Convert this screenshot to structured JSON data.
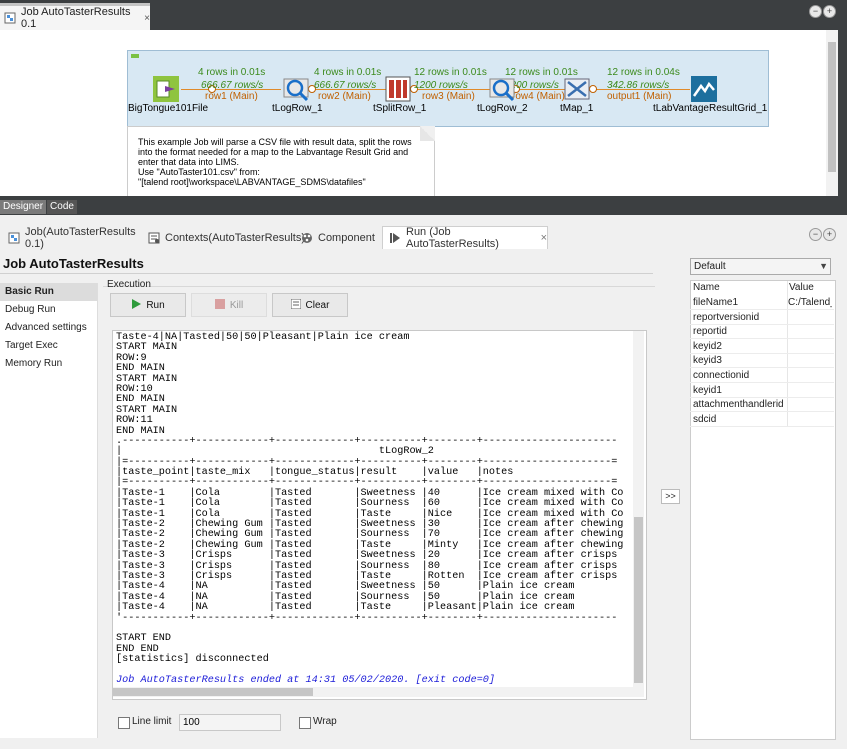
{
  "editor": {
    "tab_title": "Job AutoTasterResults 0.1",
    "tab_close": "×",
    "minimize": "−",
    "maximize": "+",
    "bottom_tabs": [
      "Designer",
      "Code"
    ]
  },
  "flows": [
    {
      "rows": "4 rows in 0.01s",
      "rate": "666.67 rows/s",
      "name": "row1 (Main)"
    },
    {
      "rows": "4 rows in 0.01s",
      "rate": "666.67 rows/s",
      "name": "row2 (Main)"
    },
    {
      "rows": "12 rows in 0.01s",
      "rate": "1200 rows/s",
      "name": "row3 (Main)"
    },
    {
      "rows": "12 rows in 0.01s",
      "rate": "1200 rows/s",
      "name": "row4 (Main)"
    },
    {
      "rows": "12 rows in 0.04s",
      "rate": "342.86 rows/s",
      "name": "output1 (Main)"
    }
  ],
  "components": [
    "BigTongue101File",
    "tLogRow_1",
    "tSplitRow_1",
    "tLogRow_2",
    "tMap_1",
    "tLabVantageResultGrid_1"
  ],
  "note_lines": [
    "This example Job will parse a CSV file with result data, split the rows",
    "into the format needed for a map to the Labvantage Result Grid and",
    "enter that data into LIMS.",
    "Use \"AutoTaster101.csv\" from:",
    "\"[talend root]\\workspace\\LABVANTAGE_SDMS\\datafiles\""
  ],
  "lower_tabs": [
    "Job(AutoTasterResults 0.1)",
    "Contexts(AutoTasterResults)",
    "Component",
    "Run (Job AutoTasterResults)"
  ],
  "lower_tab_close": "×",
  "run": {
    "title": "Job AutoTasterResults",
    "side_items": [
      "Basic Run",
      "Debug Run",
      "Advanced settings",
      "Target Exec",
      "Memory Run"
    ],
    "execution_label": "Execution",
    "run_label": "Run",
    "kill_label": "Kill",
    "clear_label": "Clear",
    "line_limit_label": "Line limit",
    "line_limit_value": "100",
    "wrap_label": "Wrap",
    "expand_label": ">>"
  },
  "console": {
    "lines": [
      "Taste-4|NA|Tasted|50|50|Pleasant|Plain ice cream",
      "START MAIN",
      "ROW:9",
      "END MAIN",
      "START MAIN",
      "ROW:10",
      "END MAIN",
      "START MAIN",
      "ROW:11",
      "END MAIN",
      ".-----------+------------+-------------+----------+--------+----------------------",
      "|                                          tLogRow_2                               ",
      "|=----------+------------+-------------+----------+--------+---------------------=",
      "|taste_point|taste_mix   |tongue_status|result    |value   |notes                 ",
      "|=----------+------------+-------------+----------+--------+---------------------=",
      "|Taste-1    |Cola        |Tasted       |Sweetness |40      |Ice cream mixed with Co",
      "|Taste-1    |Cola        |Tasted       |Sourness  |60      |Ice cream mixed with Co",
      "|Taste-1    |Cola        |Tasted       |Taste     |Nice    |Ice cream mixed with Co",
      "|Taste-2    |Chewing Gum |Tasted       |Sweetness |30      |Ice cream after chewing",
      "|Taste-2    |Chewing Gum |Tasted       |Sourness  |70      |Ice cream after chewing",
      "|Taste-2    |Chewing Gum |Tasted       |Taste     |Minty   |Ice cream after chewing",
      "|Taste-3    |Crisps      |Tasted       |Sweetness |20      |Ice cream after crisps ",
      "|Taste-3    |Crisps      |Tasted       |Sourness  |80      |Ice cream after crisps ",
      "|Taste-3    |Crisps      |Tasted       |Taste     |Rotten  |Ice cream after crisps ",
      "|Taste-4    |NA          |Tasted       |Sweetness |50      |Plain ice cream        ",
      "|Taste-4    |NA          |Tasted       |Sourness  |50      |Plain ice cream        ",
      "|Taste-4    |NA          |Tasted       |Taste     |Pleasant|Plain ice cream        ",
      "'-----------+------------+-------------+----------+--------+----------------------",
      "",
      "START END",
      "END END",
      "[statistics] disconnected",
      ""
    ],
    "final_line": "Job AutoTasterResults ended at 14:31 05/02/2020. [exit code=0]"
  },
  "context": {
    "selected": "Default",
    "header_name": "Name",
    "header_value": "Value",
    "rows": [
      {
        "name": "fileName1",
        "value": "C:/Talend_"
      },
      {
        "name": "reportversionid",
        "value": ""
      },
      {
        "name": "reportid",
        "value": ""
      },
      {
        "name": "keyid2",
        "value": ""
      },
      {
        "name": "keyid3",
        "value": ""
      },
      {
        "name": "connectionid",
        "value": ""
      },
      {
        "name": "keyid1",
        "value": ""
      },
      {
        "name": "attachmenthandlerid",
        "value": ""
      },
      {
        "name": "sdcid",
        "value": ""
      }
    ]
  },
  "icons": {
    "file_input": "csv-file-input-icon",
    "log": "log-row-icon",
    "split": "split-row-icon",
    "map": "map-icon",
    "labvantage": "labvantage-grid-icon",
    "run": "run-triangle-icon",
    "kill": "kill-icon",
    "clear": "clear-icon"
  },
  "colors": {
    "flow_stats": "#3b8a1c",
    "flow_name": "#c06000",
    "subjob_bg": "#d8e8f3",
    "exit_line": "#1c1cd8"
  }
}
